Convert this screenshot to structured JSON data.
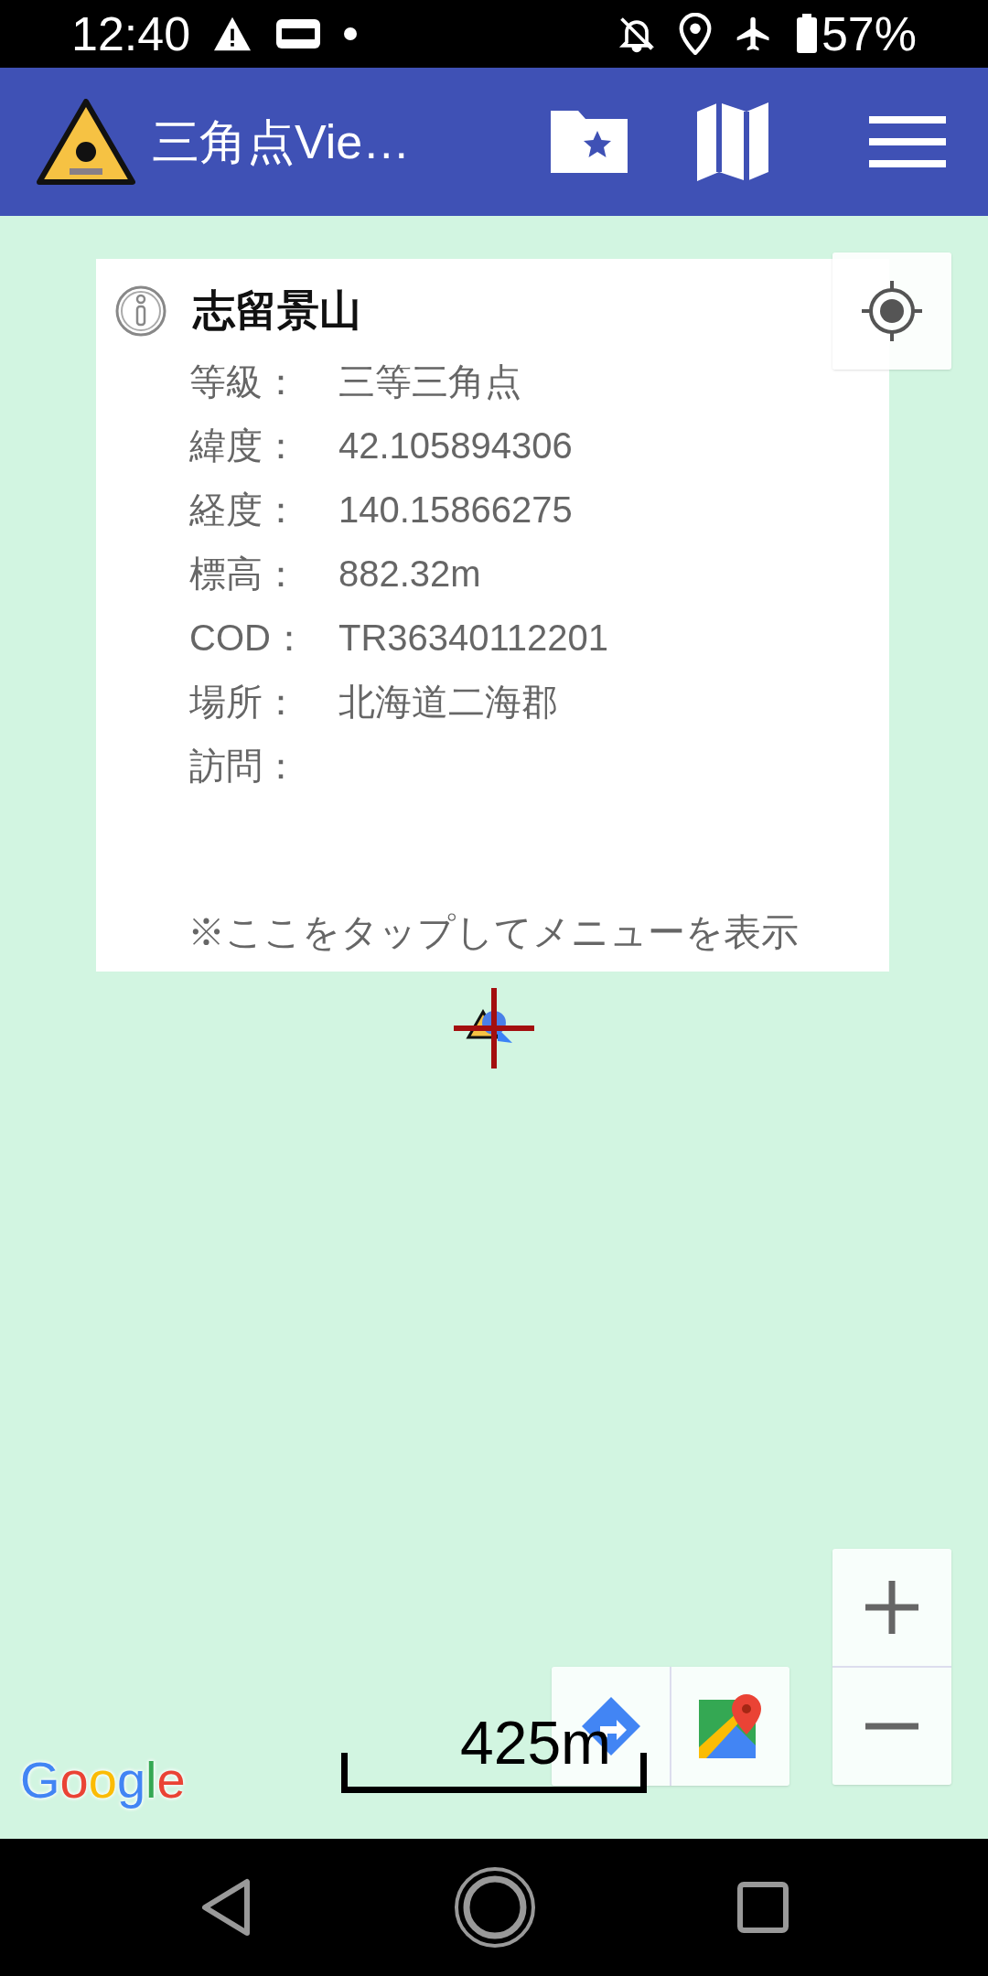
{
  "status_bar": {
    "time": "12:40",
    "battery": "57%"
  },
  "app_bar": {
    "title": "三角点Vie…"
  },
  "info_card": {
    "title": "志留景山",
    "rows": [
      {
        "label": "等級：",
        "value": "三等三角点"
      },
      {
        "label": "緯度：",
        "value": "42.105894306"
      },
      {
        "label": "経度：",
        "value": "140.15866275"
      },
      {
        "label": "標高：",
        "value": "882.32m"
      },
      {
        "label": "COD：",
        "value": "TR36340112201"
      },
      {
        "label": "場所：",
        "value": "北海道二海郡"
      },
      {
        "label": "訪問："
      }
    ],
    "hint": "※ここをタップしてメニューを表示"
  },
  "scale": {
    "label": "425m"
  },
  "attribution": "Google"
}
